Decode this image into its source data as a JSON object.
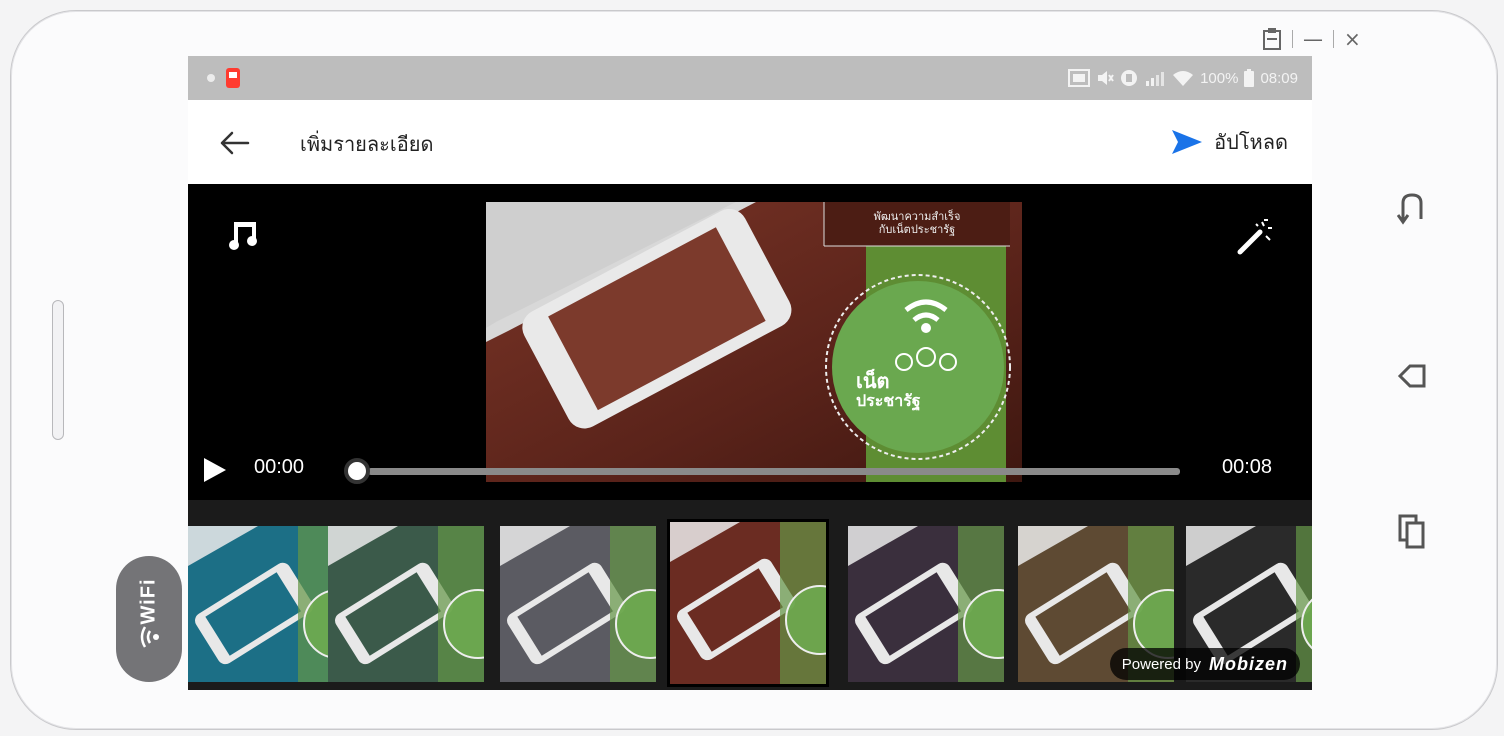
{
  "window": {
    "controls": [
      "—",
      "×"
    ]
  },
  "status_bar": {
    "battery": "100%",
    "time": "08:09"
  },
  "app_bar": {
    "title": "เพิ่มรายละเอียด",
    "upload_label": "อัปโหลด"
  },
  "video": {
    "overlay_text_line1": "พัฒนาความสำเร็จ",
    "overlay_text_line2": "กับเน็ตประชารัฐ",
    "badge_line1": "เน็ต",
    "badge_line2": "ประชารัฐ",
    "current_time": "00:00",
    "duration": "00:08",
    "progress": 0
  },
  "filters": {
    "selected_index": 3,
    "items": [
      {
        "name": "filter-1",
        "tint": "#1c6f86"
      },
      {
        "name": "filter-2",
        "tint": "#3b5a4a"
      },
      {
        "name": "filter-3",
        "tint": "#5b5b62"
      },
      {
        "name": "filter-4",
        "tint": "#6b2c22"
      },
      {
        "name": "filter-5",
        "tint": "#3a2f3d"
      },
      {
        "name": "filter-6",
        "tint": "#5e4a33"
      },
      {
        "name": "filter-7",
        "tint": "#2a2a2a"
      }
    ]
  },
  "watermark": {
    "prefix": "Powered by",
    "brand": "Mobizen"
  },
  "wifi_badge": {
    "label": "WiFi"
  },
  "colors": {
    "accent": "#1a73e8",
    "statusbar": "#bdbdbd",
    "badge_green": "#6aa84f"
  }
}
